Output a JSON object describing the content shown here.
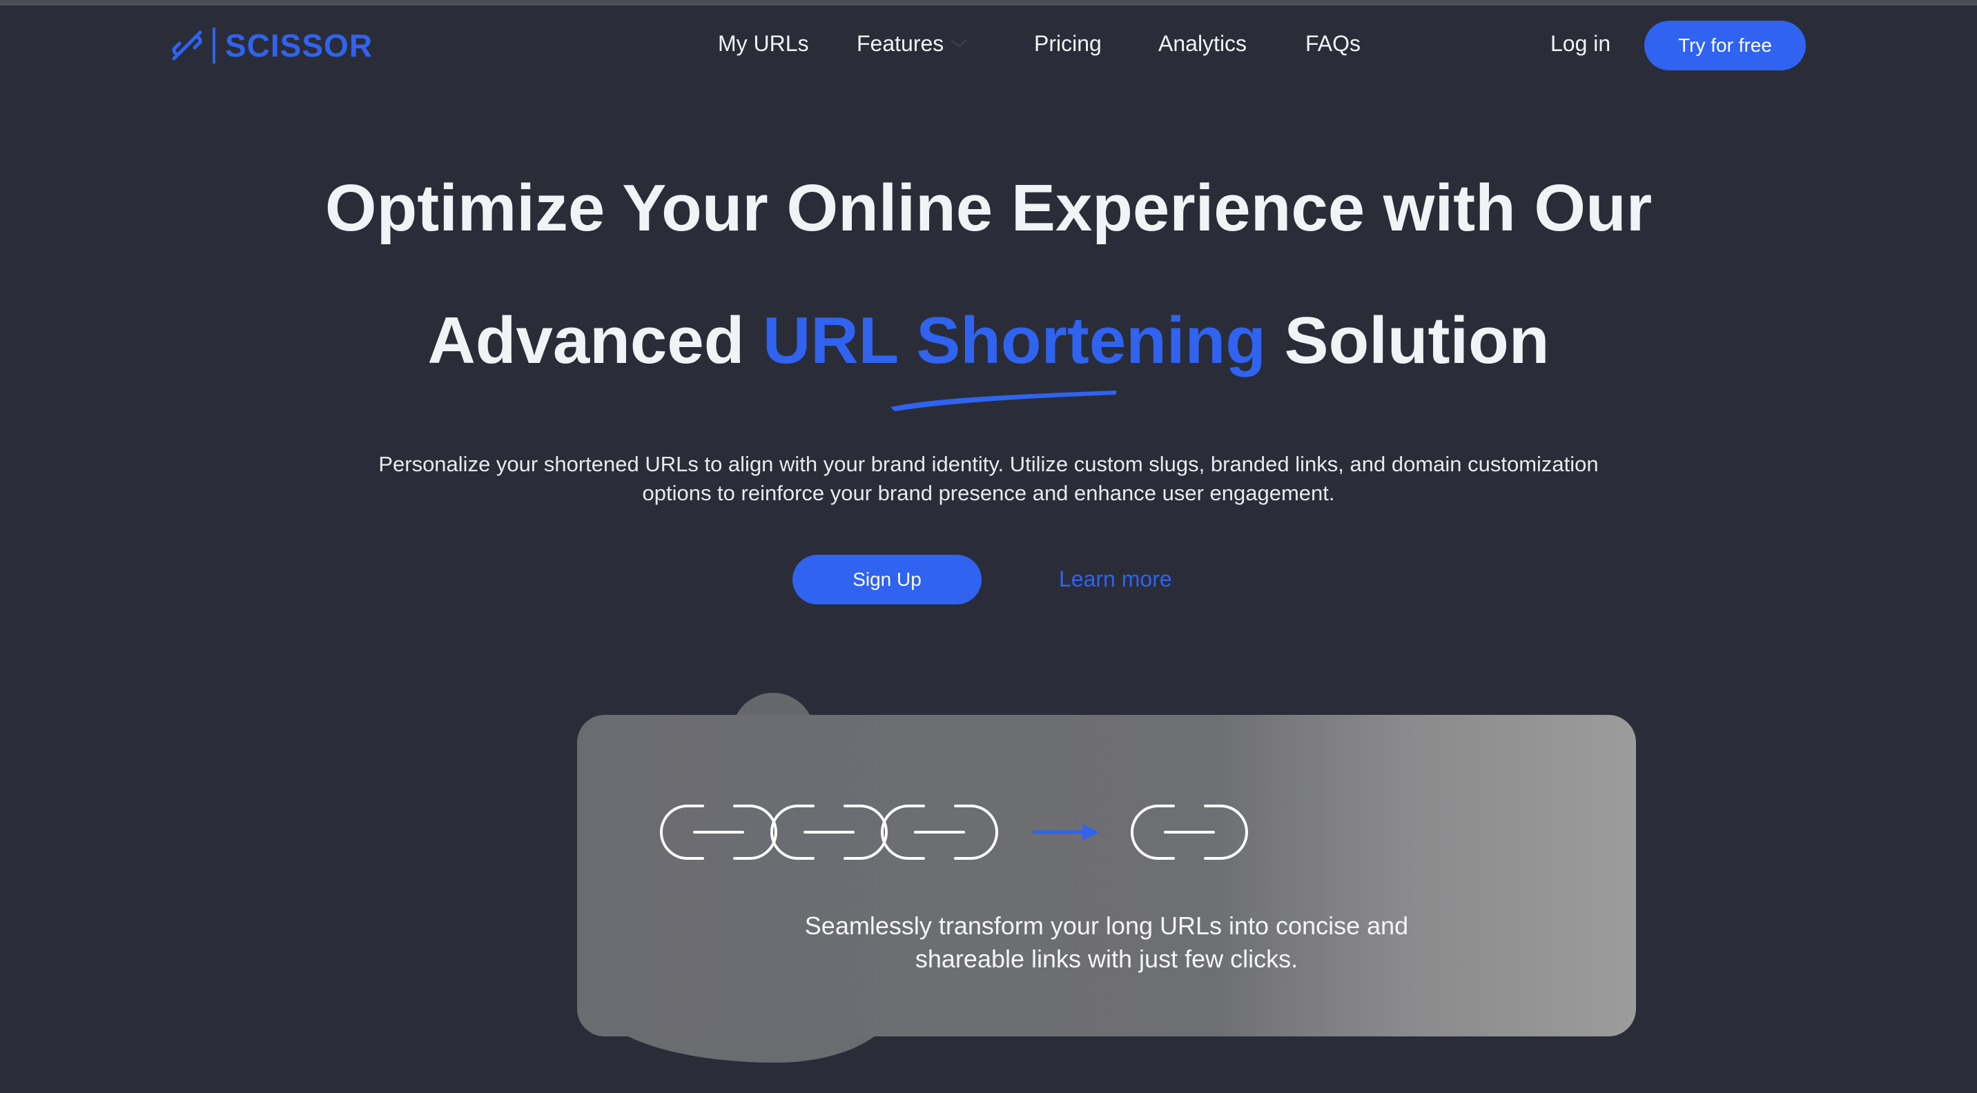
{
  "brand": {
    "name": "SCISSOR",
    "logo_icon": "broken-link-icon",
    "accent_color": "#2f63f0"
  },
  "nav": {
    "links": [
      "My URLs",
      "Features",
      "Pricing",
      "Analytics",
      "FAQs"
    ],
    "login": "Log in",
    "cta": "Try for free"
  },
  "hero": {
    "title_line1": "Optimize Your Online Experience with Our",
    "title_line2_pre": "Advanced ",
    "title_line2_accent": "URL Shortening",
    "title_line2_post": " Solution",
    "subtitle_line1": "Personalize your shortened URLs to align with your brand identity. Utilize custom slugs, branded links, and domain customization",
    "subtitle_line2": "options to reinforce your brand presence and enhance user engagement.",
    "primary_button": "Sign Up",
    "secondary_link": "Learn more"
  },
  "card": {
    "illustration": [
      "chain-link-icon",
      "chain-link-icon",
      "chain-link-icon",
      "arrow-right-icon",
      "chain-link-icon"
    ],
    "text_line1": "Seamlessly transform your long URLs into concise and",
    "text_line2": "shareable links with just few clicks."
  }
}
